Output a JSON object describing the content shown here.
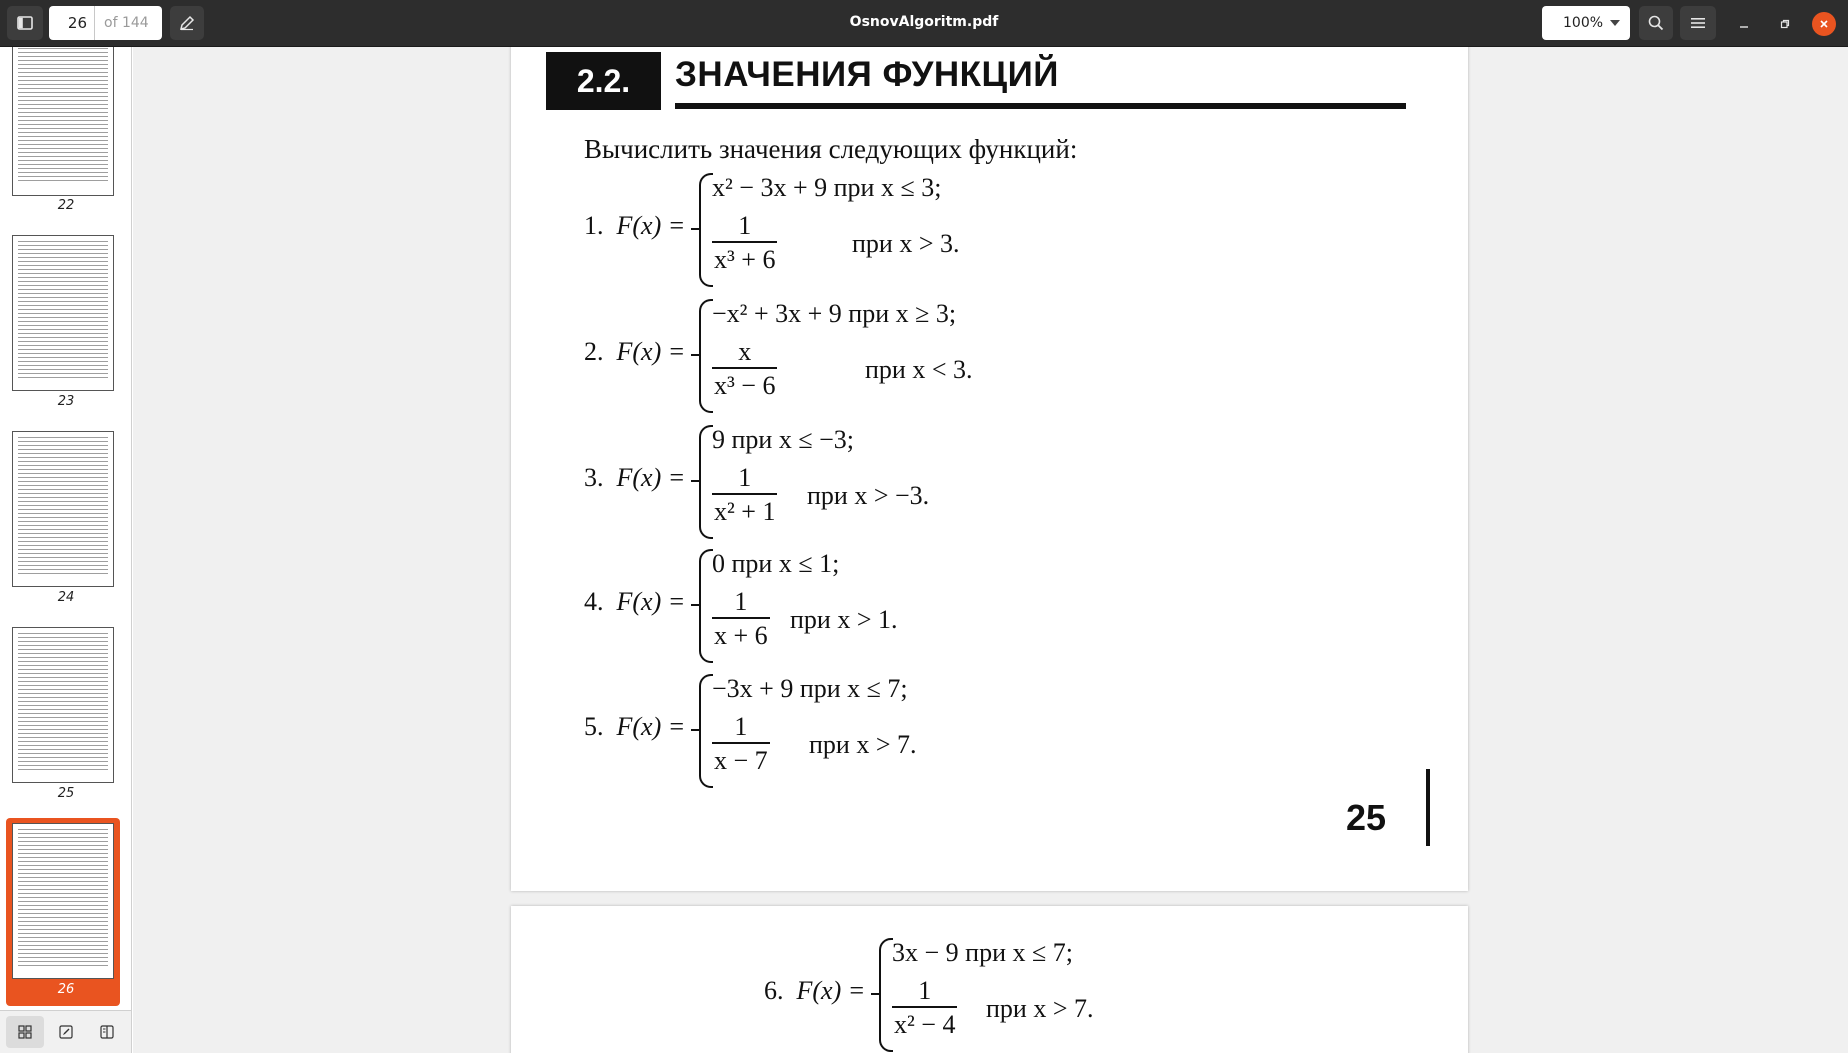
{
  "header": {
    "page_current": "26",
    "page_total": "of 144",
    "title": "OsnovAlgoritm.pdf",
    "zoom": "100%"
  },
  "sidebar": {
    "thumbnails": [
      {
        "label": "22"
      },
      {
        "label": "23"
      },
      {
        "label": "24"
      },
      {
        "label": "25"
      },
      {
        "label": "26",
        "active": true
      }
    ]
  },
  "document": {
    "section_number": "2.2.",
    "section_title": "ЗНАЧЕНИЯ ФУНКЦИЙ",
    "intro": "Вычислить значения следующих функций:",
    "page_number": "25",
    "functions": [
      {
        "num": "1.",
        "lhs": "F(x) =",
        "case1_expr": "x² − 3x + 9  при x ≤ 3;",
        "frac_num": "1",
        "frac_den": "x³ + 6",
        "case2_cond": "при x > 3."
      },
      {
        "num": "2.",
        "lhs": "F(x) =",
        "case1_expr": "−x² + 3x + 9 при x ≥ 3;",
        "frac_num": "x",
        "frac_den": "x³ − 6",
        "case2_cond": "при x < 3."
      },
      {
        "num": "3.",
        "lhs": "F(x) =",
        "case1_expr": "9          при x ≤ −3;",
        "frac_num": "1",
        "frac_den": "x² + 1",
        "case2_cond": "при x > −3."
      },
      {
        "num": "4.",
        "lhs": "F(x) =",
        "case1_expr": "0          при x ≤ 1;",
        "frac_num": "1",
        "frac_den": "x + 6",
        "case2_cond": "при x > 1."
      },
      {
        "num": "5.",
        "lhs": "F(x) =",
        "case1_expr": "−3x + 9 при x ≤ 7;",
        "frac_num": "1",
        "frac_den": "x − 7",
        "case2_cond": "при x > 7."
      },
      {
        "num": "6.",
        "lhs": "F(x) =",
        "case1_expr": "3x − 9   при x ≤ 7;",
        "frac_num": "1",
        "frac_den": "x² − 4",
        "case2_cond": "при x > 7."
      }
    ]
  },
  "icons": {
    "sidebar_toggle": "sidebar-icon",
    "annotate": "pencil-icon",
    "search": "search-icon",
    "menu": "hamburger-icon",
    "minimize": "minimize-icon",
    "maximize": "maximize-icon",
    "close": "close-icon",
    "tab_thumbnails": "grid-icon",
    "tab_annotations": "annotations-icon",
    "tab_outline": "outline-icon"
  },
  "colors": {
    "accent": "#e95420",
    "header_bg": "#2d2d2d",
    "doc_bg": "#f0f0f0"
  }
}
